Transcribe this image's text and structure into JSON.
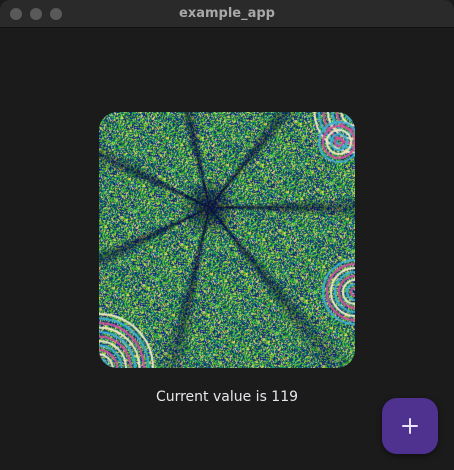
{
  "window": {
    "title": "example_app",
    "controls": [
      "close",
      "minimize",
      "maximize"
    ]
  },
  "main": {
    "fractal_image": "fractal-image",
    "status_text": "Current value is 119",
    "counter_value": 119
  },
  "fab": {
    "icon": "plus-icon",
    "color": "#4f318f"
  },
  "colors": {
    "background": "#1c1b1c",
    "titlebar": "#2b2a2b",
    "text": "#e8e6ea"
  }
}
